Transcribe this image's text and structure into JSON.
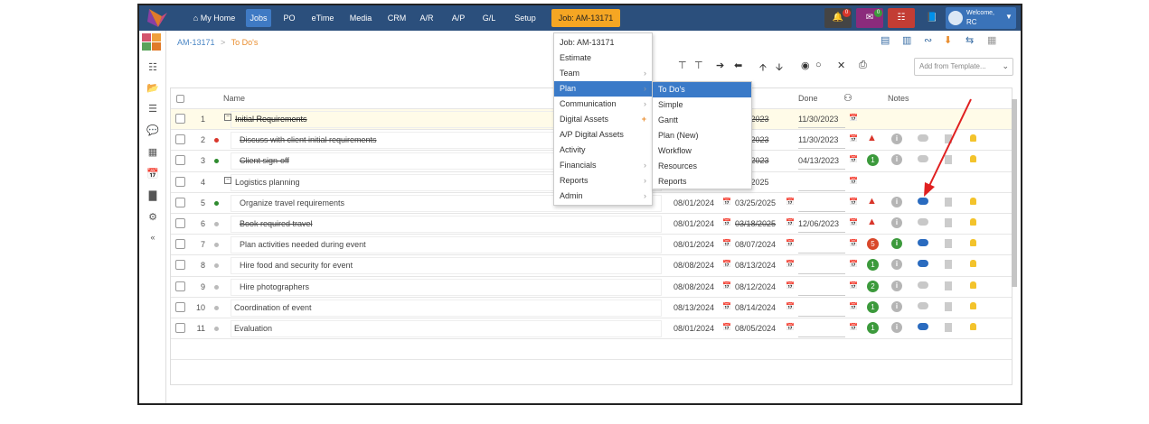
{
  "nav": {
    "items": [
      "My Home",
      "Jobs",
      "PO",
      "eTime",
      "Media",
      "CRM",
      "A/R",
      "A/P",
      "G/L",
      "Setup"
    ],
    "job": "Job: AM-13171",
    "badges": {
      "alerts": "0",
      "mail": "0"
    },
    "welcome": "Welcome,",
    "user": "RC"
  },
  "breadcrumb": {
    "root": "AM-13171",
    "sep": ">",
    "current": "To Do's"
  },
  "template": {
    "placeholder": "Add from Template..."
  },
  "grid": {
    "headers": {
      "name": "Name",
      "done": "Done",
      "notes": "Notes"
    },
    "rows": [
      {
        "num": "1",
        "name": "Initial Requirements",
        "group": true,
        "strike": true,
        "dot": "",
        "start": "",
        "due": "1/2023",
        "done": "11/30/2023",
        "warn": false,
        "count": "",
        "info": false,
        "chat": false
      },
      {
        "num": "2",
        "name": "Discuss with client initial requirements",
        "group": false,
        "strike": true,
        "dot": "red",
        "start": "",
        "due": "1/2023",
        "done": "11/30/2023",
        "warn": true,
        "count": "",
        "info": false,
        "chat": false
      },
      {
        "num": "3",
        "name": "Client sign-off",
        "group": false,
        "strike": true,
        "dot": "green",
        "start": "",
        "due": "5/2023",
        "done": "04/13/2023",
        "warn": false,
        "count": "1",
        "info": false,
        "chat": false
      },
      {
        "num": "4",
        "name": "Logistics planning",
        "group": true,
        "strike": false,
        "dot": "",
        "start": "",
        "due": "5/2025",
        "done": "",
        "warn": false,
        "count": "",
        "info": false,
        "chat": false
      },
      {
        "num": "5",
        "name": "Organize travel requirements",
        "group": false,
        "strike": false,
        "dot": "green",
        "start": "08/01/2024",
        "due": "03/25/2025",
        "done": "",
        "warn": true,
        "count": "",
        "info": false,
        "chat": true
      },
      {
        "num": "6",
        "name": "Book required travel",
        "group": false,
        "strike": true,
        "dot": "grey",
        "start": "08/01/2024",
        "due": "03/18/2025",
        "done": "12/06/2023",
        "warn": true,
        "count": "",
        "info": false,
        "chat": false
      },
      {
        "num": "7",
        "name": "Plan activities needed during event",
        "group": false,
        "strike": false,
        "dot": "grey",
        "start": "08/01/2024",
        "due": "08/07/2024",
        "done": "",
        "warn": false,
        "count": "5",
        "info": true,
        "chat": true
      },
      {
        "num": "8",
        "name": "Hire food and security for event",
        "group": false,
        "strike": false,
        "dot": "grey",
        "start": "08/08/2024",
        "due": "08/13/2024",
        "done": "",
        "warn": false,
        "count": "1",
        "info": false,
        "chat": true
      },
      {
        "num": "9",
        "name": "Hire photographers",
        "group": false,
        "strike": false,
        "dot": "grey",
        "start": "08/08/2024",
        "due": "08/12/2024",
        "done": "",
        "warn": false,
        "count": "2",
        "info": false,
        "chat": false
      },
      {
        "num": "10",
        "name": "Coordination of event",
        "group": false,
        "strike": false,
        "dot": "grey",
        "start": "08/13/2024",
        "due": "08/14/2024",
        "done": "",
        "warn": false,
        "count": "1",
        "info": false,
        "chat": false
      },
      {
        "num": "11",
        "name": "Evaluation",
        "group": false,
        "strike": false,
        "dot": "grey",
        "start": "08/01/2024",
        "due": "08/05/2024",
        "done": "",
        "warn": false,
        "count": "1",
        "info": false,
        "chat": true
      }
    ]
  },
  "menu": {
    "items": [
      {
        "label": "Job: AM-13171",
        "arrow": false,
        "plus": false
      },
      {
        "label": "Estimate",
        "arrow": false,
        "plus": false
      },
      {
        "label": "Team",
        "arrow": true,
        "plus": false
      },
      {
        "label": "Plan",
        "arrow": true,
        "plus": false,
        "selected": true
      },
      {
        "label": "Communication",
        "arrow": true,
        "plus": false
      },
      {
        "label": "Digital Assets",
        "arrow": false,
        "plus": true
      },
      {
        "label": "A/P Digital Assets",
        "arrow": false,
        "plus": false
      },
      {
        "label": "Activity",
        "arrow": false,
        "plus": false
      },
      {
        "label": "Financials",
        "arrow": true,
        "plus": false
      },
      {
        "label": "Reports",
        "arrow": true,
        "plus": false
      },
      {
        "label": "Admin",
        "arrow": true,
        "plus": false
      }
    ]
  },
  "submenu": {
    "items": [
      "To Do's",
      "Simple",
      "Gantt",
      "Plan (New)",
      "Workflow",
      "Resources",
      "Reports"
    ]
  },
  "colors": {
    "nav": "#2b4f7c",
    "accent": "#3a7ac8",
    "job": "#f5a623",
    "red": "#d9362b",
    "green": "#3c9a3c"
  }
}
